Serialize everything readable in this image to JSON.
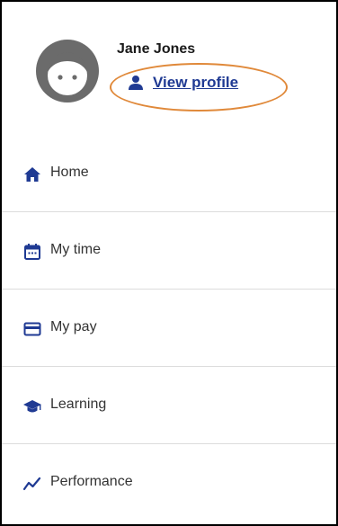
{
  "profile": {
    "name": "Jane Jones",
    "view_profile_label": "View profile",
    "avatar_icon": "default-avatar-face",
    "link_color": "#1f3a93",
    "highlight_color": "#e0893a"
  },
  "nav": {
    "icon_color": "#1f3a93",
    "items": [
      {
        "label": "Home",
        "icon": "home-icon"
      },
      {
        "label": "My time",
        "icon": "calendar-icon"
      },
      {
        "label": "My pay",
        "icon": "credit-card-icon"
      },
      {
        "label": "Learning",
        "icon": "graduation-cap-icon"
      },
      {
        "label": "Performance",
        "icon": "trend-line-icon"
      }
    ]
  }
}
